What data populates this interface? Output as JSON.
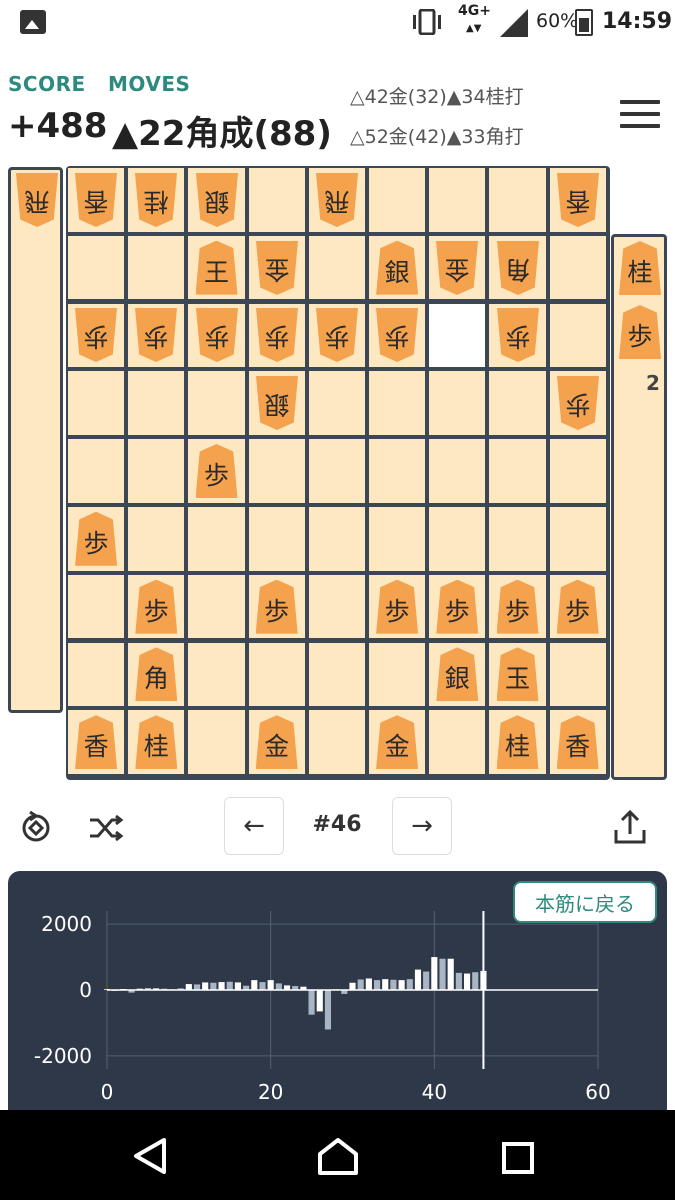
{
  "status_bar": {
    "network": "4G+",
    "battery": "60%",
    "time": "14:59"
  },
  "header": {
    "score_label": "SCORE",
    "moves_label": "MOVES",
    "score": "+488",
    "current_move": "▲22角成(88)",
    "pv_line_1": "△42金(32)▲34桂打",
    "pv_line_2": "△52金(42)▲33角打"
  },
  "board": {
    "highlight": [
      3,
      2
    ],
    "pieces": [
      {
        "row": 1,
        "col": 1,
        "k": "香",
        "gote": true
      },
      {
        "row": 1,
        "col": 2,
        "k": "桂",
        "gote": true
      },
      {
        "row": 1,
        "col": 3,
        "k": "銀",
        "gote": true
      },
      {
        "row": 1,
        "col": 5,
        "k": "飛",
        "gote": true
      },
      {
        "row": 1,
        "col": 9,
        "k": "香",
        "gote": true
      },
      {
        "row": 2,
        "col": 3,
        "k": "王",
        "gote": false
      },
      {
        "row": 2,
        "col": 4,
        "k": "金",
        "gote": true
      },
      {
        "row": 2,
        "col": 6,
        "k": "銀",
        "gote": false
      },
      {
        "row": 2,
        "col": 7,
        "k": "金",
        "gote": true
      },
      {
        "row": 2,
        "col": 8,
        "k": "角",
        "gote": true
      },
      {
        "row": 3,
        "col": 1,
        "k": "歩",
        "gote": true
      },
      {
        "row": 3,
        "col": 2,
        "k": "歩",
        "gote": true
      },
      {
        "row": 3,
        "col": 3,
        "k": "歩",
        "gote": true
      },
      {
        "row": 3,
        "col": 4,
        "k": "歩",
        "gote": true
      },
      {
        "row": 3,
        "col": 5,
        "k": "歩",
        "gote": true
      },
      {
        "row": 3,
        "col": 6,
        "k": "歩",
        "gote": true
      },
      {
        "row": 3,
        "col": 8,
        "k": "歩",
        "gote": true
      },
      {
        "row": 4,
        "col": 4,
        "k": "銀",
        "gote": true
      },
      {
        "row": 4,
        "col": 9,
        "k": "歩",
        "gote": true
      },
      {
        "row": 5,
        "col": 3,
        "k": "歩",
        "gote": false
      },
      {
        "row": 6,
        "col": 1,
        "k": "歩",
        "gote": false
      },
      {
        "row": 7,
        "col": 2,
        "k": "歩",
        "gote": false
      },
      {
        "row": 7,
        "col": 4,
        "k": "歩",
        "gote": false
      },
      {
        "row": 7,
        "col": 6,
        "k": "歩",
        "gote": false
      },
      {
        "row": 7,
        "col": 7,
        "k": "歩",
        "gote": false
      },
      {
        "row": 7,
        "col": 8,
        "k": "歩",
        "gote": false
      },
      {
        "row": 7,
        "col": 9,
        "k": "歩",
        "gote": false
      },
      {
        "row": 8,
        "col": 2,
        "k": "角",
        "gote": false
      },
      {
        "row": 8,
        "col": 7,
        "k": "銀",
        "gote": false
      },
      {
        "row": 8,
        "col": 8,
        "k": "玉",
        "gote": false
      },
      {
        "row": 9,
        "col": 1,
        "k": "香",
        "gote": false
      },
      {
        "row": 9,
        "col": 2,
        "k": "桂",
        "gote": false
      },
      {
        "row": 9,
        "col": 4,
        "k": "金",
        "gote": false
      },
      {
        "row": 9,
        "col": 6,
        "k": "金",
        "gote": false
      },
      {
        "row": 9,
        "col": 8,
        "k": "桂",
        "gote": false
      },
      {
        "row": 9,
        "col": 9,
        "k": "香",
        "gote": false
      }
    ],
    "gote_hand": [
      {
        "k": "飛",
        "count": ""
      }
    ],
    "sente_hand": [
      {
        "k": "桂",
        "count": ""
      },
      {
        "k": "歩",
        "count": "2"
      }
    ]
  },
  "controls": {
    "prev": "←",
    "move_number": "#46",
    "next": "→"
  },
  "chart_data": {
    "type": "bar",
    "x_ticks": [
      "0",
      "20",
      "40",
      "60"
    ],
    "y_ticks": [
      "2000",
      "0",
      "-2000"
    ],
    "ylim": [
      -2400,
      2400
    ],
    "xlim": [
      0,
      60
    ],
    "current_move": 46,
    "button_label": "本筋に戻る",
    "x": [
      1,
      2,
      3,
      4,
      5,
      6,
      7,
      8,
      9,
      10,
      11,
      12,
      13,
      14,
      15,
      16,
      17,
      18,
      19,
      20,
      21,
      22,
      23,
      24,
      25,
      26,
      27,
      28,
      29,
      30,
      31,
      32,
      33,
      34,
      35,
      36,
      37,
      38,
      39,
      40,
      41,
      42,
      43,
      44,
      45,
      46
    ],
    "values": [
      30,
      -20,
      30,
      -80,
      40,
      60,
      50,
      40,
      20,
      50,
      180,
      170,
      230,
      220,
      240,
      250,
      230,
      130,
      300,
      240,
      300,
      200,
      140,
      120,
      100,
      -750,
      -650,
      -1200,
      20,
      -120,
      220,
      320,
      350,
      300,
      330,
      310,
      300,
      330,
      620,
      560,
      1000,
      950,
      950,
      520,
      500,
      540,
      580
    ]
  },
  "colors": {
    "accent": "#2c8a7e",
    "board_bg": "#fde8c2",
    "piece": "#f4a24e",
    "chart_bg": "#2e3848"
  },
  "nav_icons": [
    "back-icon",
    "home-icon",
    "recents-icon"
  ]
}
